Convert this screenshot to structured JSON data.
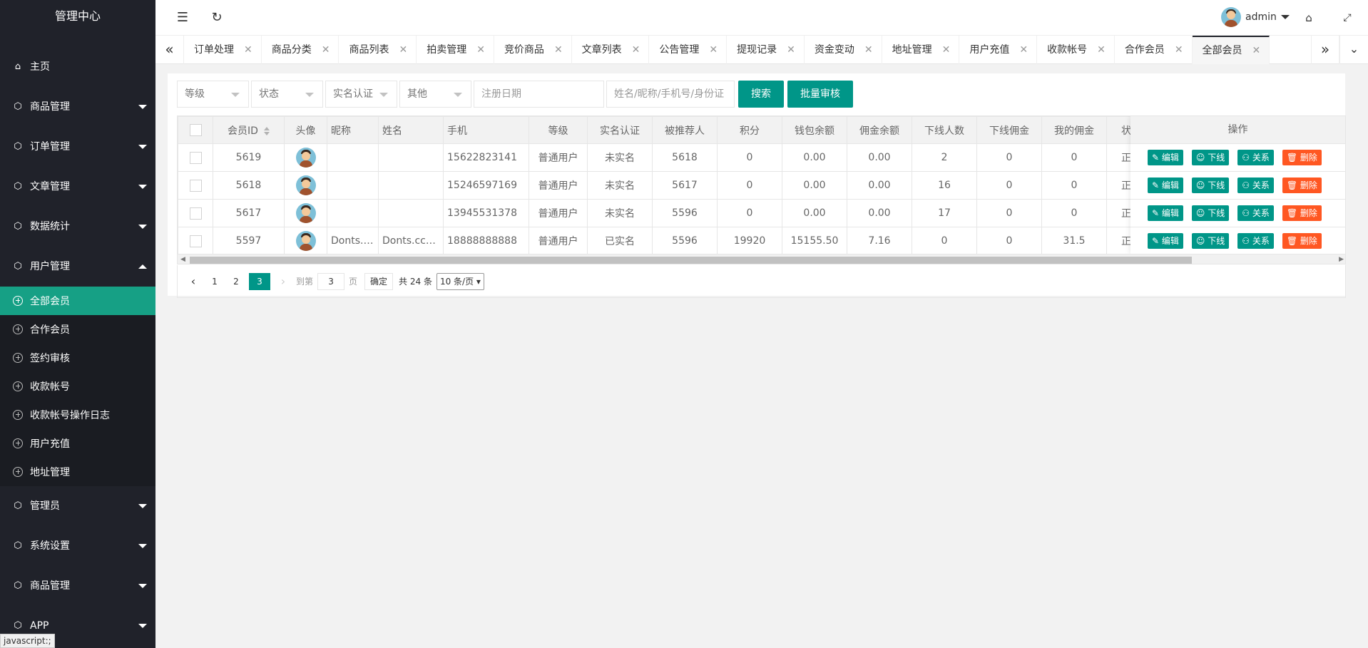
{
  "sidebar": {
    "title": "管理中心",
    "items": [
      {
        "label": "主页",
        "icon": "home-icon",
        "expandable": false
      },
      {
        "label": "商品管理",
        "icon": "cube-icon",
        "expandable": true
      },
      {
        "label": "订单管理",
        "icon": "cube-icon",
        "expandable": true
      },
      {
        "label": "文章管理",
        "icon": "cube-icon",
        "expandable": true
      },
      {
        "label": "数据统计",
        "icon": "cube-icon",
        "expandable": true
      },
      {
        "label": "用户管理",
        "icon": "cube-icon",
        "expandable": true,
        "expanded": true
      }
    ],
    "subitems": [
      {
        "label": "全部会员",
        "active": true
      },
      {
        "label": "合作会员"
      },
      {
        "label": "签约审核"
      },
      {
        "label": "收款帐号"
      },
      {
        "label": "收款帐号操作日志"
      },
      {
        "label": "用户充值"
      },
      {
        "label": "地址管理"
      }
    ],
    "items_after": [
      {
        "label": "管理员"
      },
      {
        "label": "系统设置"
      },
      {
        "label": "商品管理"
      },
      {
        "label": "APP"
      }
    ]
  },
  "status_bar": "javascript:;",
  "header": {
    "user_name": "admin",
    "icons": [
      "menu-fold-icon",
      "refresh-icon",
      "tag-icon",
      "fullscreen-icon"
    ]
  },
  "tabs": [
    {
      "label": "订单处理"
    },
    {
      "label": "商品分类"
    },
    {
      "label": "商品列表"
    },
    {
      "label": "拍卖管理"
    },
    {
      "label": "竞价商品"
    },
    {
      "label": "文章列表"
    },
    {
      "label": "公告管理"
    },
    {
      "label": "提现记录"
    },
    {
      "label": "资金变动"
    },
    {
      "label": "地址管理"
    },
    {
      "label": "用户充值"
    },
    {
      "label": "收款帐号"
    },
    {
      "label": "合作会员"
    },
    {
      "label": "全部会员",
      "active": true
    }
  ],
  "filters": {
    "level": "等级",
    "status": "状态",
    "realname": "实名认证",
    "other": "其他",
    "date_placeholder": "注册日期",
    "search_placeholder": "姓名/昵称/手机号/身份证",
    "search_btn": "搜索",
    "batch_btn": "批量审核"
  },
  "table": {
    "columns": [
      "会员ID",
      "头像",
      "昵称",
      "姓名",
      "手机",
      "等级",
      "实名认证",
      "被推荐人",
      "积分",
      "钱包余额",
      "佣金余额",
      "下线人数",
      "下线佣金",
      "我的佣金",
      "状"
    ],
    "ops_header": "操作",
    "rows": [
      {
        "id": "5619",
        "nick": "",
        "name": "",
        "phone": "15622823141",
        "level": "普通用户",
        "realname": "未实名",
        "referrer": "5618",
        "points": "0",
        "wallet": "0.00",
        "commission": "0.00",
        "downline": "2",
        "down_comm": "0",
        "my_comm": "0",
        "state": "正"
      },
      {
        "id": "5618",
        "nick": "",
        "name": "",
        "phone": "15246597169",
        "level": "普通用户",
        "realname": "未实名",
        "referrer": "5617",
        "points": "0",
        "wallet": "0.00",
        "commission": "0.00",
        "downline": "16",
        "down_comm": "0",
        "my_comm": "0",
        "state": "正"
      },
      {
        "id": "5617",
        "nick": "",
        "name": "",
        "phone": "13945531378",
        "level": "普通用户",
        "realname": "未实名",
        "referrer": "5596",
        "points": "0",
        "wallet": "0.00",
        "commission": "0.00",
        "downline": "17",
        "down_comm": "0",
        "my_comm": "0",
        "state": "正"
      },
      {
        "id": "5597",
        "nick": "Donts.…",
        "name": "Donts.cc…",
        "phone": "18888888888",
        "level": "普通用户",
        "realname": "已实名",
        "referrer": "5596",
        "points": "19920",
        "wallet": "15155.50",
        "commission": "7.16",
        "downline": "0",
        "down_comm": "0",
        "my_comm": "31.5",
        "state": "正"
      }
    ],
    "op_buttons": {
      "edit": "编辑",
      "down": "下线",
      "rel": "关系",
      "del": "删除"
    }
  },
  "pager": {
    "pages": [
      "1",
      "2",
      "3"
    ],
    "current": "3",
    "goto_label": "到第",
    "goto_value": "3",
    "page_unit": "页",
    "confirm": "确定",
    "total": "共 24 条",
    "limit": "10 条/页"
  },
  "colors": {
    "primary": "#009688",
    "danger": "#ff5722",
    "sidebar": "#20222a",
    "active": "#16a085"
  }
}
